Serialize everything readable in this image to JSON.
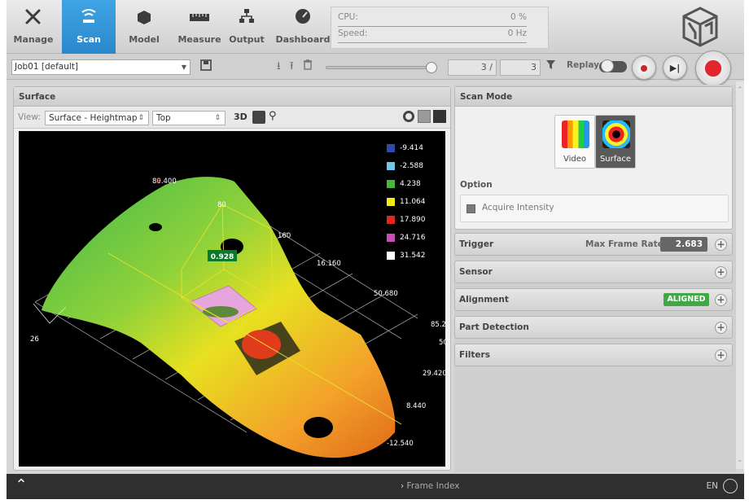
{
  "nav": {
    "items": [
      {
        "label": "Manage",
        "icon": "tools-icon"
      },
      {
        "label": "Scan",
        "icon": "scan-icon",
        "active": true
      },
      {
        "label": "Model",
        "icon": "model-icon"
      },
      {
        "label": "Measure",
        "icon": "ruler-icon"
      },
      {
        "label": "Output",
        "icon": "network-icon"
      },
      {
        "label": "Dashboard",
        "icon": "gauge-icon"
      }
    ]
  },
  "performance": {
    "cpu_label": "CPU:",
    "cpu_value": "0 %",
    "speed_label": "Speed:",
    "speed_value": "0 Hz"
  },
  "toolbar": {
    "job": "Job01 [default]",
    "frame_current": "3 /",
    "frame_total": "3",
    "replay_label": "Replay",
    "replay_enabled": true
  },
  "surface_panel": {
    "title": "Surface",
    "view_label": "View:",
    "view_value": "Surface - Heightmap",
    "orientation_value": "Top",
    "mode_3d": "3D",
    "measurement": "0.928",
    "legend": [
      {
        "value": "-9.414",
        "color": "#2f4aa8"
      },
      {
        "value": "-2.588",
        "color": "#6fc9e8"
      },
      {
        "value": "4.238",
        "color": "#44b83a"
      },
      {
        "value": "11.064",
        "color": "#f2ea10"
      },
      {
        "value": "17.890",
        "color": "#e82620"
      },
      {
        "value": "24.716",
        "color": "#c84fb3"
      },
      {
        "value": "31.542",
        "color": "#ffffff"
      }
    ],
    "axis_labels": [
      "80.400",
      "80",
      "160",
      "16.160",
      "50.680",
      "85.2",
      "50",
      "29.420",
      "8.440",
      "-12.540",
      "26"
    ]
  },
  "scan_mode": {
    "title": "Scan Mode",
    "modes": [
      {
        "label": "Video",
        "selected": false
      },
      {
        "label": "Surface",
        "selected": true
      }
    ],
    "option_label": "Option",
    "acquire_intensity": "Acquire Intensity"
  },
  "sections": {
    "trigger": "Trigger",
    "max_frame_rate_label": "Max Frame Rate:",
    "max_frame_rate_value": "2.683",
    "sensor": "Sensor",
    "alignment": "Alignment",
    "alignment_status": "ALIGNED",
    "part_detection": "Part Detection",
    "filters": "Filters"
  },
  "bottom": {
    "frame_index": "Frame Index",
    "language": "EN"
  }
}
